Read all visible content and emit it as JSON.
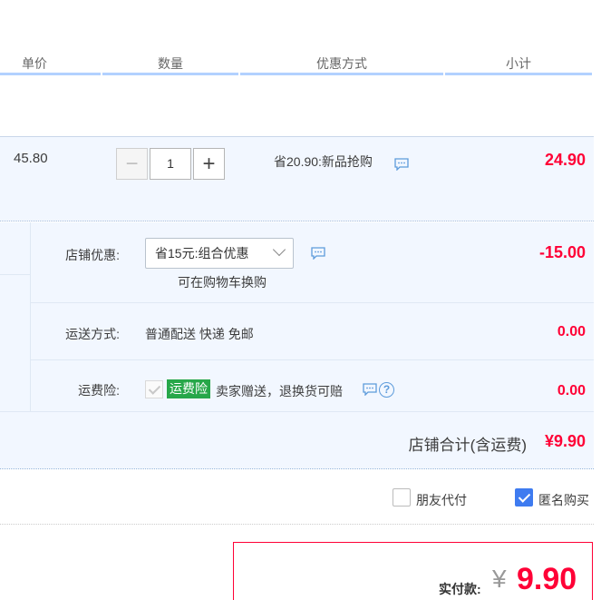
{
  "header": {
    "col_price": "单价",
    "col_qty": "数量",
    "col_promo": "优惠方式",
    "col_subtotal": "小计"
  },
  "item": {
    "unit_price": "45.80",
    "quantity": "1",
    "minus_symbol": "−",
    "plus_symbol": "+",
    "promo_text": "省20.90:新品抢购",
    "subtotal": "24.90"
  },
  "shop": {
    "discount_label": "店铺优惠:",
    "discount_selected": "省15元:组合优惠",
    "discount_hint": "可在购物车换购",
    "discount_amount": "-15.00",
    "shipping_label": "运送方式:",
    "shipping_value": "普通配送 快递 免邮",
    "shipping_amount": "0.00",
    "insurance_label": "运费险:",
    "insurance_badge": "运费险",
    "insurance_text": "卖家赠送，退换货可赔",
    "insurance_amount": "0.00",
    "total_label": "店铺合计(含运费)",
    "total_value": "¥9.90"
  },
  "options": {
    "friend_pay_label": "朋友代付",
    "friend_pay_checked": false,
    "anonymous_label": "匿名购买",
    "anonymous_checked": true
  },
  "payment": {
    "label": "实付款:",
    "currency": "¥",
    "amount": "9.90"
  },
  "colors": {
    "accent_red": "#ff0036",
    "accent_blue": "#3e7bf0",
    "badge_green": "#27a749",
    "section_bg": "#f2f7ff"
  }
}
